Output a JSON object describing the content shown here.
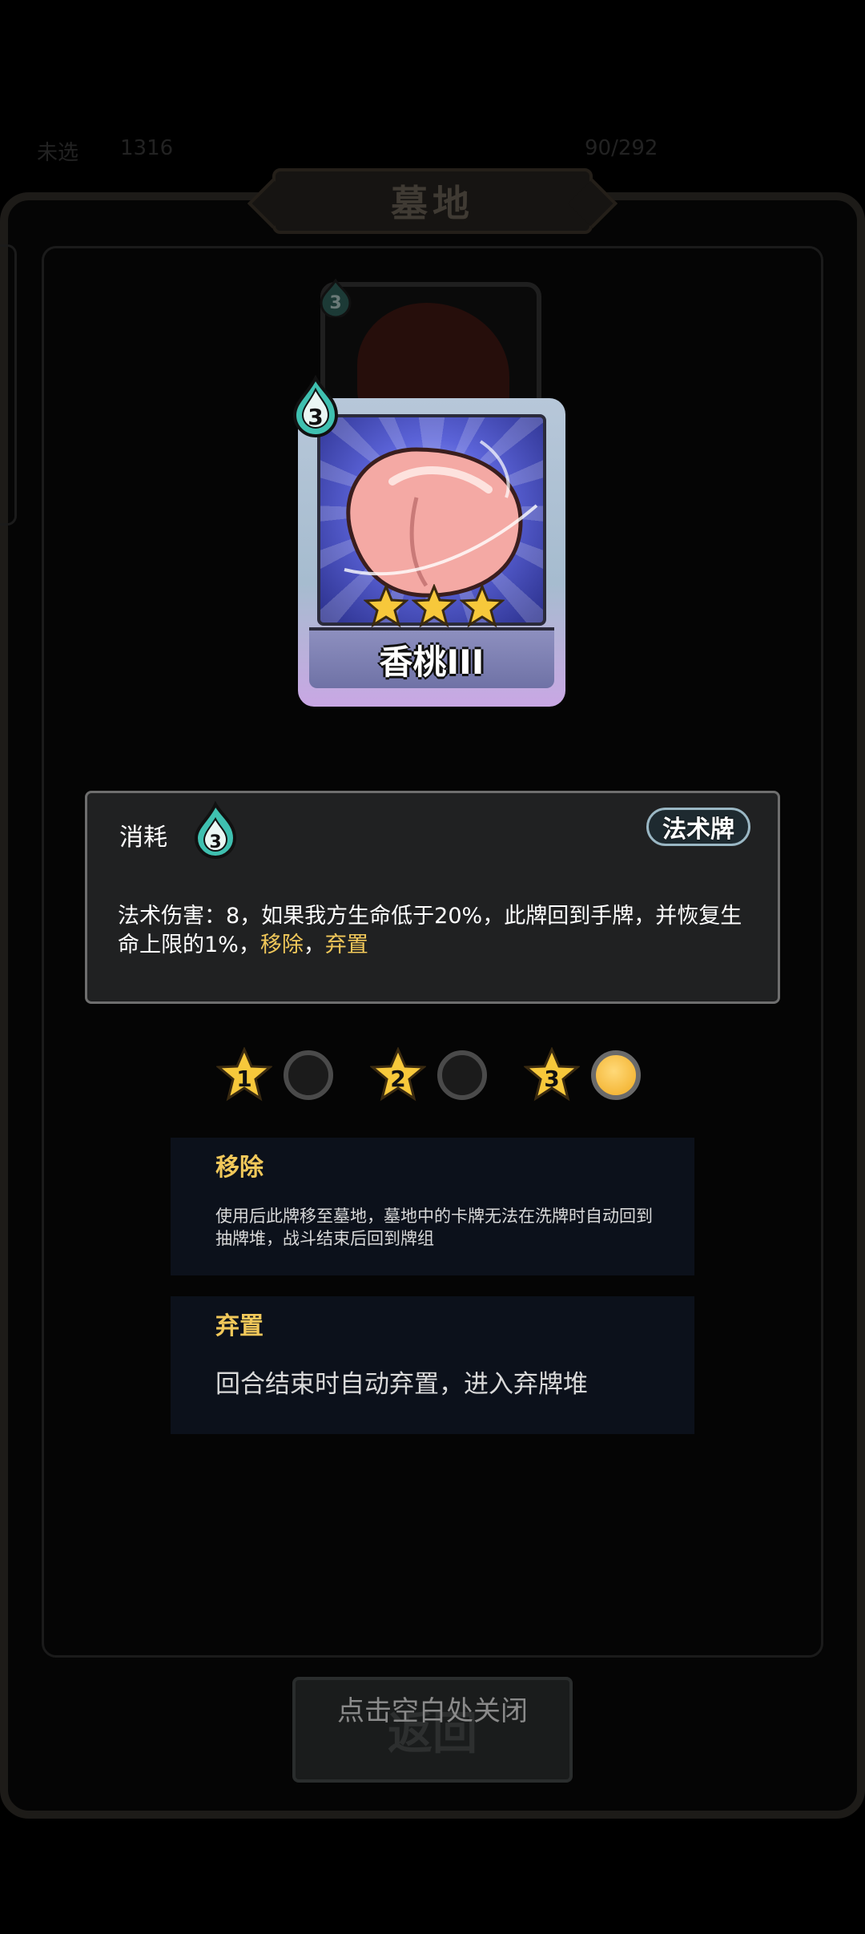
{
  "hud": {
    "left_label": "未选",
    "gold": "1316",
    "hp": "90/292"
  },
  "panel": {
    "title": "墓地"
  },
  "card": {
    "name": "香桃III",
    "cost": "3",
    "back_cost": "3",
    "stars": 3
  },
  "description": {
    "consume_label": "消耗",
    "consume_value": "3",
    "type_badge": "法术牌",
    "text_main": "法术伤害：8，如果我方生命低于20%，此牌回到手牌，并恢复生命上限的1%，",
    "kw1": "移除",
    "sep": "，",
    "kw2": "弃置"
  },
  "levels": [
    {
      "label": "1",
      "active": false
    },
    {
      "label": "2",
      "active": false
    },
    {
      "label": "3",
      "active": true
    }
  ],
  "keywords": [
    {
      "title": "移除",
      "desc": "使用后此牌移至墓地，墓地中的卡牌无法在洗牌时自动回到抽牌堆，战斗结束后回到牌组"
    },
    {
      "title": "弃置",
      "desc": "回合结束时自动弃置，进入弃牌堆"
    }
  ],
  "return_button": "返回",
  "close_hint": "点击空白处关闭",
  "colors": {
    "keyword": "#f1c85a",
    "panel_bg": "#050505",
    "keyword_box_bg": "#0c111b",
    "desc_box_bg": "#202122"
  }
}
